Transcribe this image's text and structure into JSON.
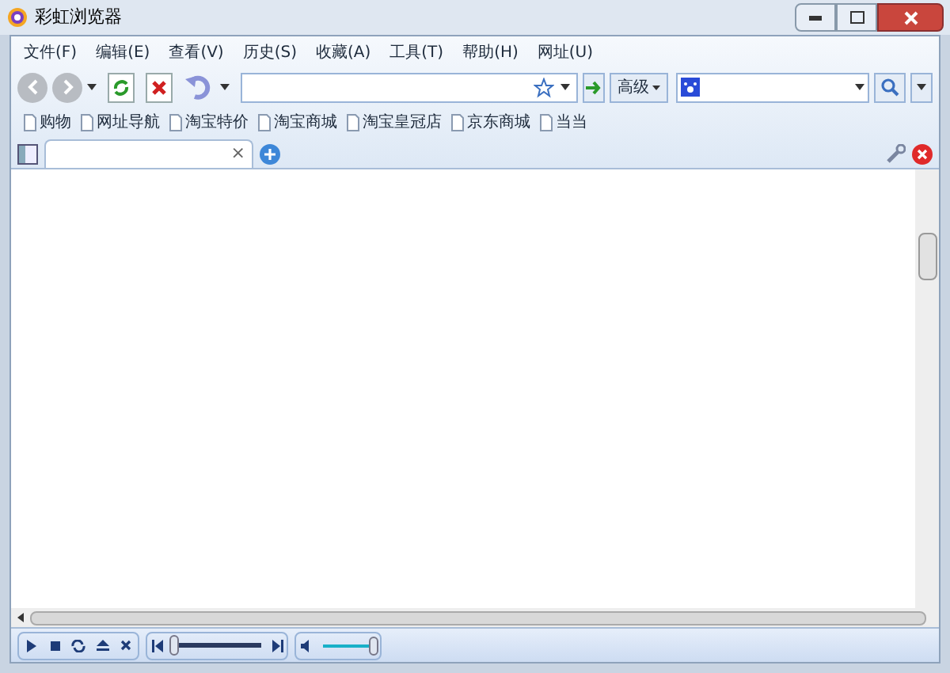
{
  "window": {
    "title": "彩虹浏览器"
  },
  "menu": [
    "文件(F)",
    "编辑(E)",
    "查看(V)",
    "历史(S)",
    "收藏(A)",
    "工具(T)",
    "帮助(H)",
    "网址(U)"
  ],
  "toolbar": {
    "advanced_button": "高级"
  },
  "bookmarks": [
    "购物",
    "网址导航",
    "淘宝特价",
    "淘宝商城",
    "淘宝皇冠店",
    "京东商城",
    "当当"
  ],
  "tabs": [
    {
      "close": "×",
      "selected": true
    }
  ],
  "player": {
    "progress": {
      "level": 0.02
    },
    "volume": {
      "level": 1.0
    }
  }
}
